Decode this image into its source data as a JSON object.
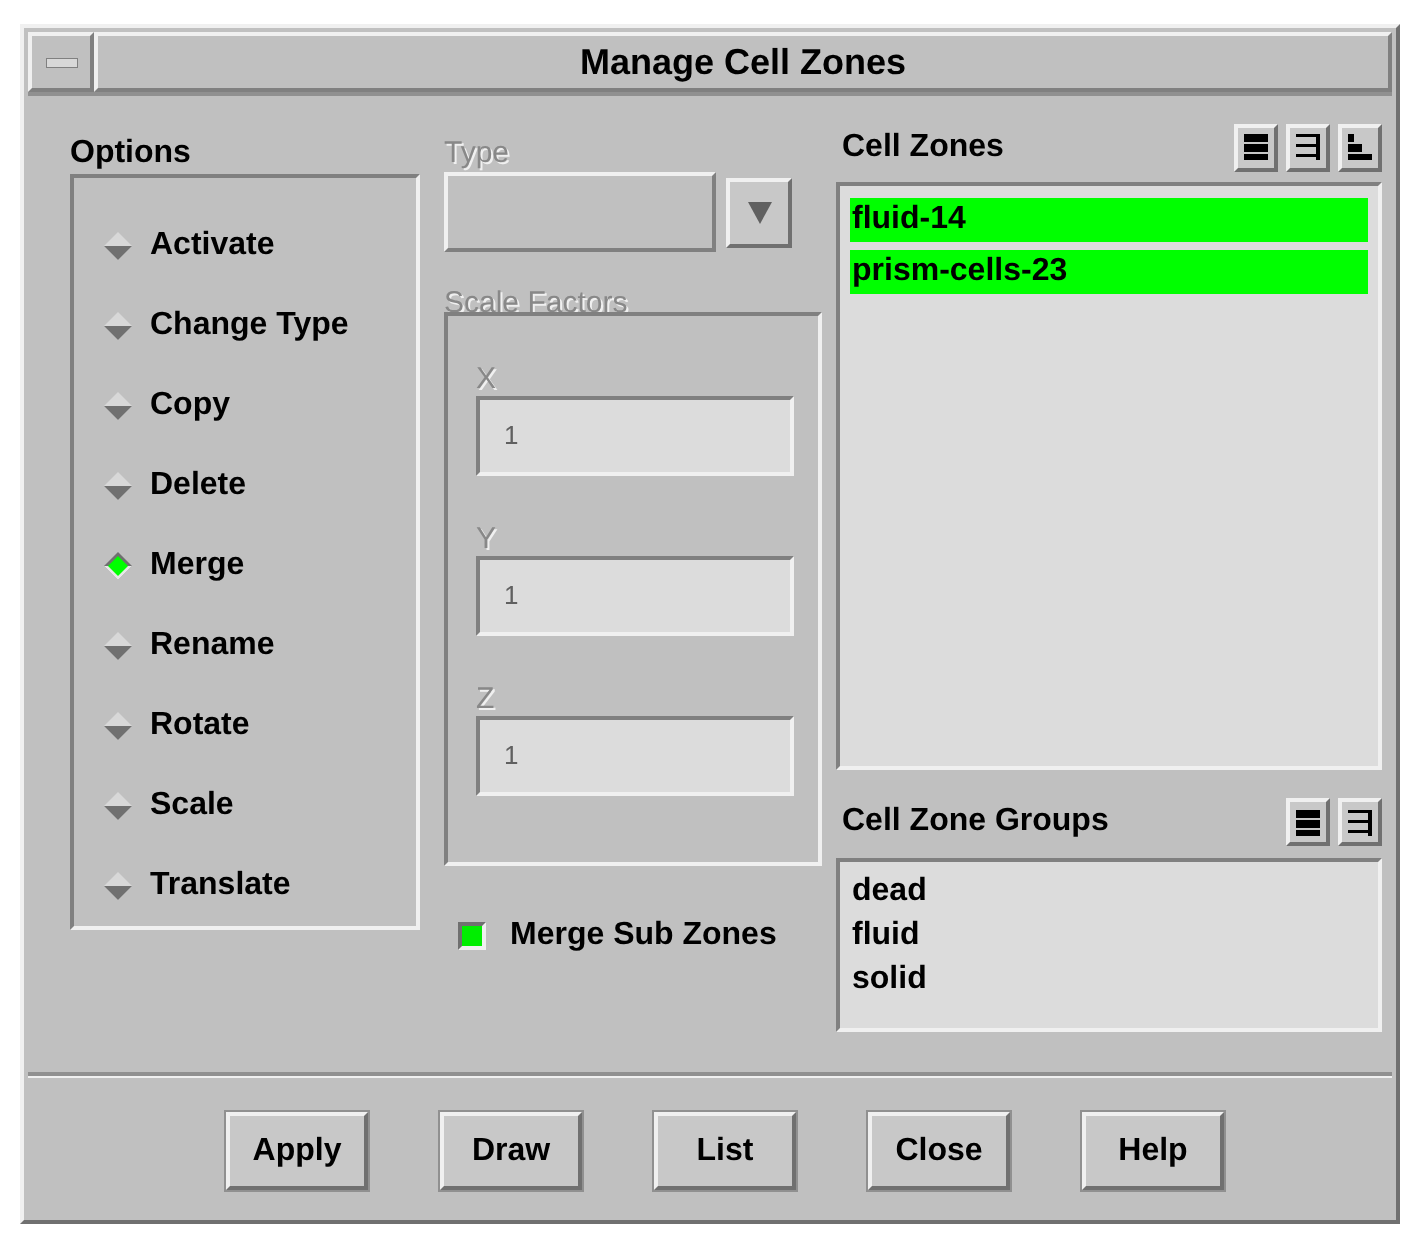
{
  "window": {
    "title": "Manage Cell Zones"
  },
  "options": {
    "label": "Options",
    "items": [
      {
        "label": "Activate",
        "selected": false
      },
      {
        "label": "Change Type",
        "selected": false
      },
      {
        "label": "Copy",
        "selected": false
      },
      {
        "label": "Delete",
        "selected": false
      },
      {
        "label": "Merge",
        "selected": true
      },
      {
        "label": "Rename",
        "selected": false
      },
      {
        "label": "Rotate",
        "selected": false
      },
      {
        "label": "Scale",
        "selected": false
      },
      {
        "label": "Translate",
        "selected": false
      }
    ]
  },
  "type": {
    "label": "Type",
    "disabled": true
  },
  "scale_factors": {
    "label": "Scale Factors",
    "disabled": true,
    "fields": [
      {
        "label": "X",
        "value": "1"
      },
      {
        "label": "Y",
        "value": "1"
      },
      {
        "label": "Z",
        "value": "1"
      }
    ]
  },
  "merge_sub_zones": {
    "label": "Merge Sub Zones",
    "checked": true
  },
  "cell_zones": {
    "label": "Cell Zones",
    "items": [
      {
        "label": "fluid-14",
        "selected": true
      },
      {
        "label": "prism-cells-23",
        "selected": true
      }
    ]
  },
  "cell_zone_groups": {
    "label": "Cell Zone Groups",
    "items": [
      {
        "label": "dead",
        "selected": false
      },
      {
        "label": "fluid",
        "selected": false
      },
      {
        "label": "solid",
        "selected": false
      }
    ]
  },
  "buttons": [
    "Apply",
    "Draw",
    "List",
    "Close",
    "Help"
  ]
}
